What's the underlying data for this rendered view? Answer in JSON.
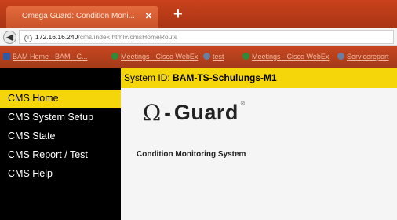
{
  "browser": {
    "tab": {
      "title": "Omega Guard: Condition Moni..."
    },
    "address": {
      "host": "172.16.16.240",
      "path": "/cms/index.html#/cmsHomeRoute"
    },
    "bookmarks": [
      {
        "label": "BAM Home - BAM - C...",
        "icon_color": "#2b5ba8"
      },
      {
        "label": "Meetings - Cisco WebEx",
        "icon_color": "#2f8a3a"
      },
      {
        "label": "test",
        "icon_color": "#6a7fa0"
      },
      {
        "label": "Meetings - Cisco WebEx",
        "icon_color": "#2f8a3a"
      },
      {
        "label": "Servicereport",
        "icon_color": "#6a7fa0"
      }
    ]
  },
  "sidebar": {
    "items": [
      {
        "label": "CMS Home",
        "active": true
      },
      {
        "label": "CMS System Setup",
        "active": false
      },
      {
        "label": "CMS State",
        "active": false
      },
      {
        "label": "CMS Report / Test",
        "active": false
      },
      {
        "label": "CMS Help",
        "active": false
      }
    ]
  },
  "header": {
    "system_prefix": "System ID:",
    "system_id": "BAM-TS-Schulungs-M1"
  },
  "logo": {
    "omega": "Ω",
    "dash": "-",
    "word": "Guard",
    "reg": "®"
  },
  "main": {
    "subtitle": "Condition Monitoring System"
  },
  "colors": {
    "accent": "#f5d60a",
    "sidebar": "#000000",
    "browser_chrome": "#b83c18"
  }
}
